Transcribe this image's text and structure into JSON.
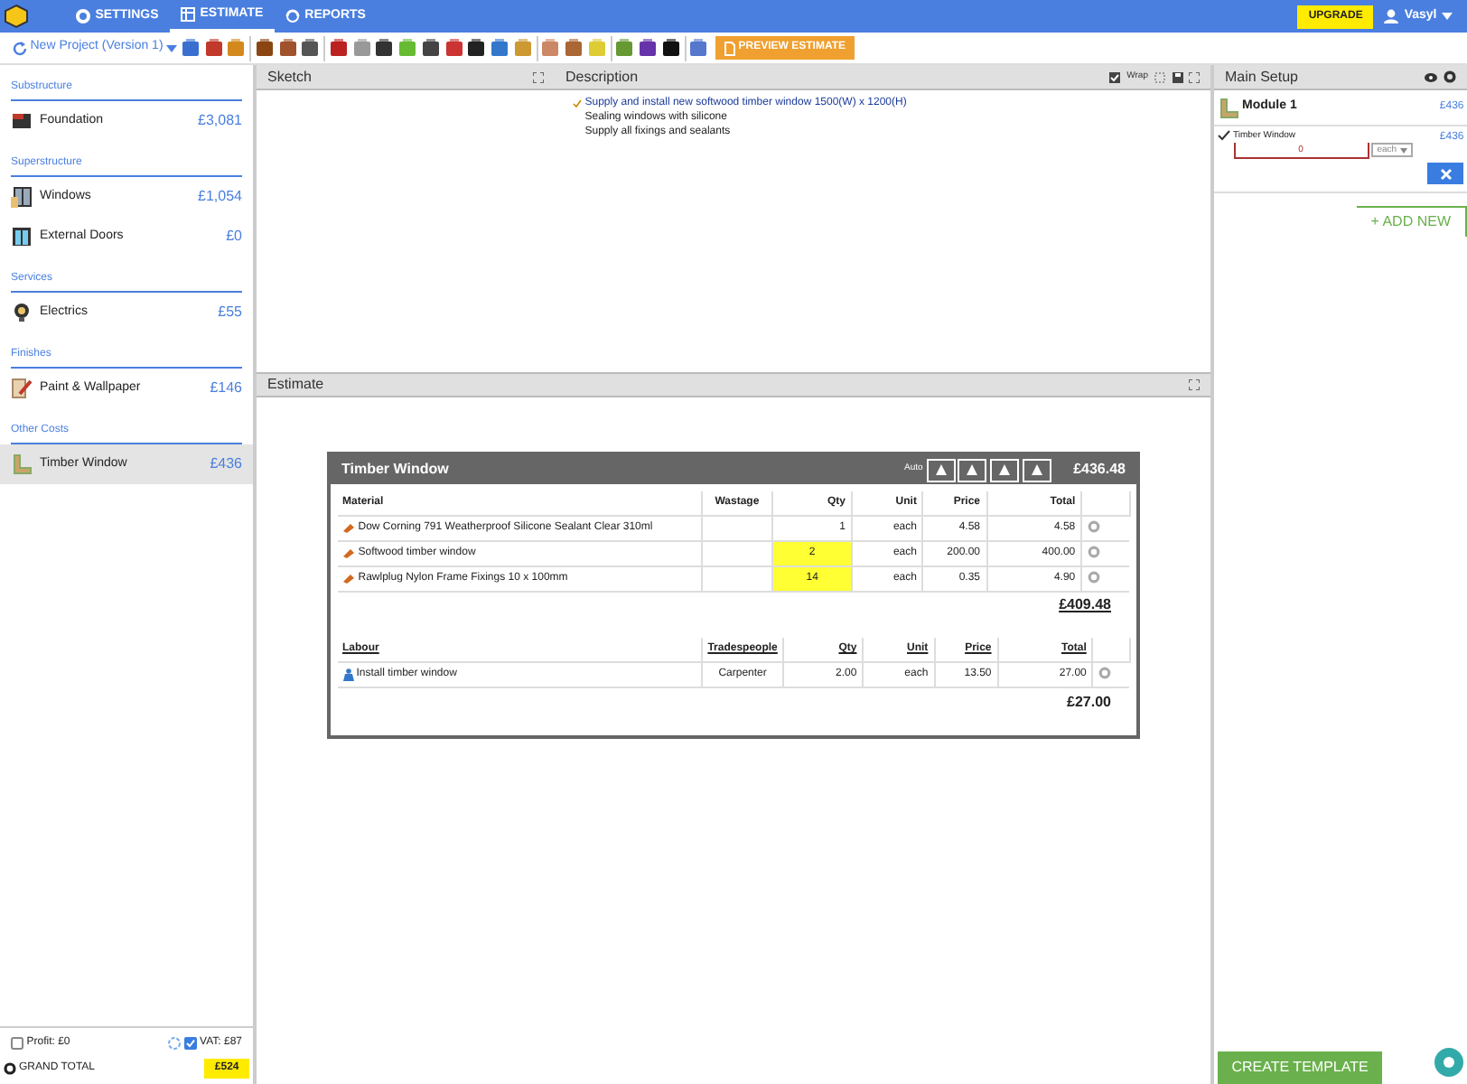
{
  "nav": {
    "tabs": [
      {
        "label": "SETTINGS",
        "selected": false
      },
      {
        "label": "ESTIMATE",
        "selected": true
      },
      {
        "label": "REPORTS",
        "selected": false
      }
    ],
    "upgrade": "UPGRADE",
    "user": "Vasyl"
  },
  "toolbar": {
    "project": "New Project (Version 1)",
    "preview": "PREVIEW ESTIMATE"
  },
  "sidebar": {
    "groups": [
      {
        "title": "Substructure",
        "items": [
          {
            "name": "Foundation",
            "amount": "£3,081",
            "selected": false,
            "kind": "brick"
          }
        ]
      },
      {
        "title": "Superstructure",
        "items": [
          {
            "name": "Windows",
            "amount": "£1,054",
            "selected": false,
            "kind": "window"
          },
          {
            "name": "External Doors",
            "amount": "£0",
            "selected": false,
            "kind": "door"
          }
        ]
      },
      {
        "title": "Services",
        "items": [
          {
            "name": "Electrics",
            "amount": "£55",
            "selected": false,
            "kind": "bulb"
          }
        ]
      },
      {
        "title": "Finishes",
        "items": [
          {
            "name": "Paint & Wallpaper",
            "amount": "£146",
            "selected": false,
            "kind": "paint"
          }
        ]
      },
      {
        "title": "Other Costs",
        "items": [
          {
            "name": "Timber Window",
            "amount": "£436",
            "selected": true,
            "kind": "frame"
          }
        ]
      }
    ],
    "footer": {
      "profit": {
        "label": "Profit: £0",
        "checked": false
      },
      "vat": {
        "label": "VAT: £87",
        "checked": true
      },
      "grand_total": "GRAND TOTAL",
      "total": "£524"
    }
  },
  "sketch": {
    "title": "Sketch"
  },
  "description": {
    "title": "Description",
    "wrap": {
      "label": "Wrap",
      "checked": true
    },
    "lines": [
      {
        "text": "Supply and install new softwood timber window 1500(W) x 1200(H)",
        "checked": true
      },
      {
        "text": "Sealing windows with silicone",
        "checked": false
      },
      {
        "text": "Supply all fixings and sealants",
        "checked": false
      }
    ]
  },
  "estimate": {
    "title": "Estimate",
    "card": {
      "title": "Timber Window",
      "auto": "Auto",
      "total": "£436.48",
      "materials": {
        "columns": [
          "Material",
          "Wastage",
          "Qty",
          "Unit",
          "Price",
          "Total"
        ],
        "rows": [
          {
            "cells": [
              "Dow Corning 791 Weatherproof Silicone Sealant Clear 310ml",
              "",
              "1",
              "each",
              "4.58",
              "4.58"
            ],
            "highlight": false
          },
          {
            "cells": [
              "Softwood timber window",
              "",
              "2",
              "each",
              "200.00",
              "400.00"
            ],
            "highlight": true
          },
          {
            "cells": [
              "Rawlplug Nylon Frame Fixings 10 x 100mm",
              "",
              "14",
              "each",
              "0.35",
              "4.90"
            ],
            "highlight": true
          }
        ],
        "total": "£409.48"
      },
      "labour": {
        "columns": [
          "Labour",
          "Tradespeople",
          "Qty",
          "Unit",
          "Price",
          "Total"
        ],
        "rows": [
          {
            "cells": [
              "Install timber window",
              "Carpenter",
              "2.00",
              "each",
              "13.50",
              "27.00"
            ],
            "highlight": false
          }
        ],
        "total": "£27.00"
      }
    }
  },
  "main_setup": {
    "title": "Main Setup",
    "module": {
      "name": "Module 1",
      "amount": "£436"
    },
    "field": {
      "label": "Timber Window",
      "value": "0",
      "unit": "each",
      "amount": "£436"
    },
    "add_new": "+ ADD NEW",
    "create_template": "CREATE TEMPLATE"
  }
}
